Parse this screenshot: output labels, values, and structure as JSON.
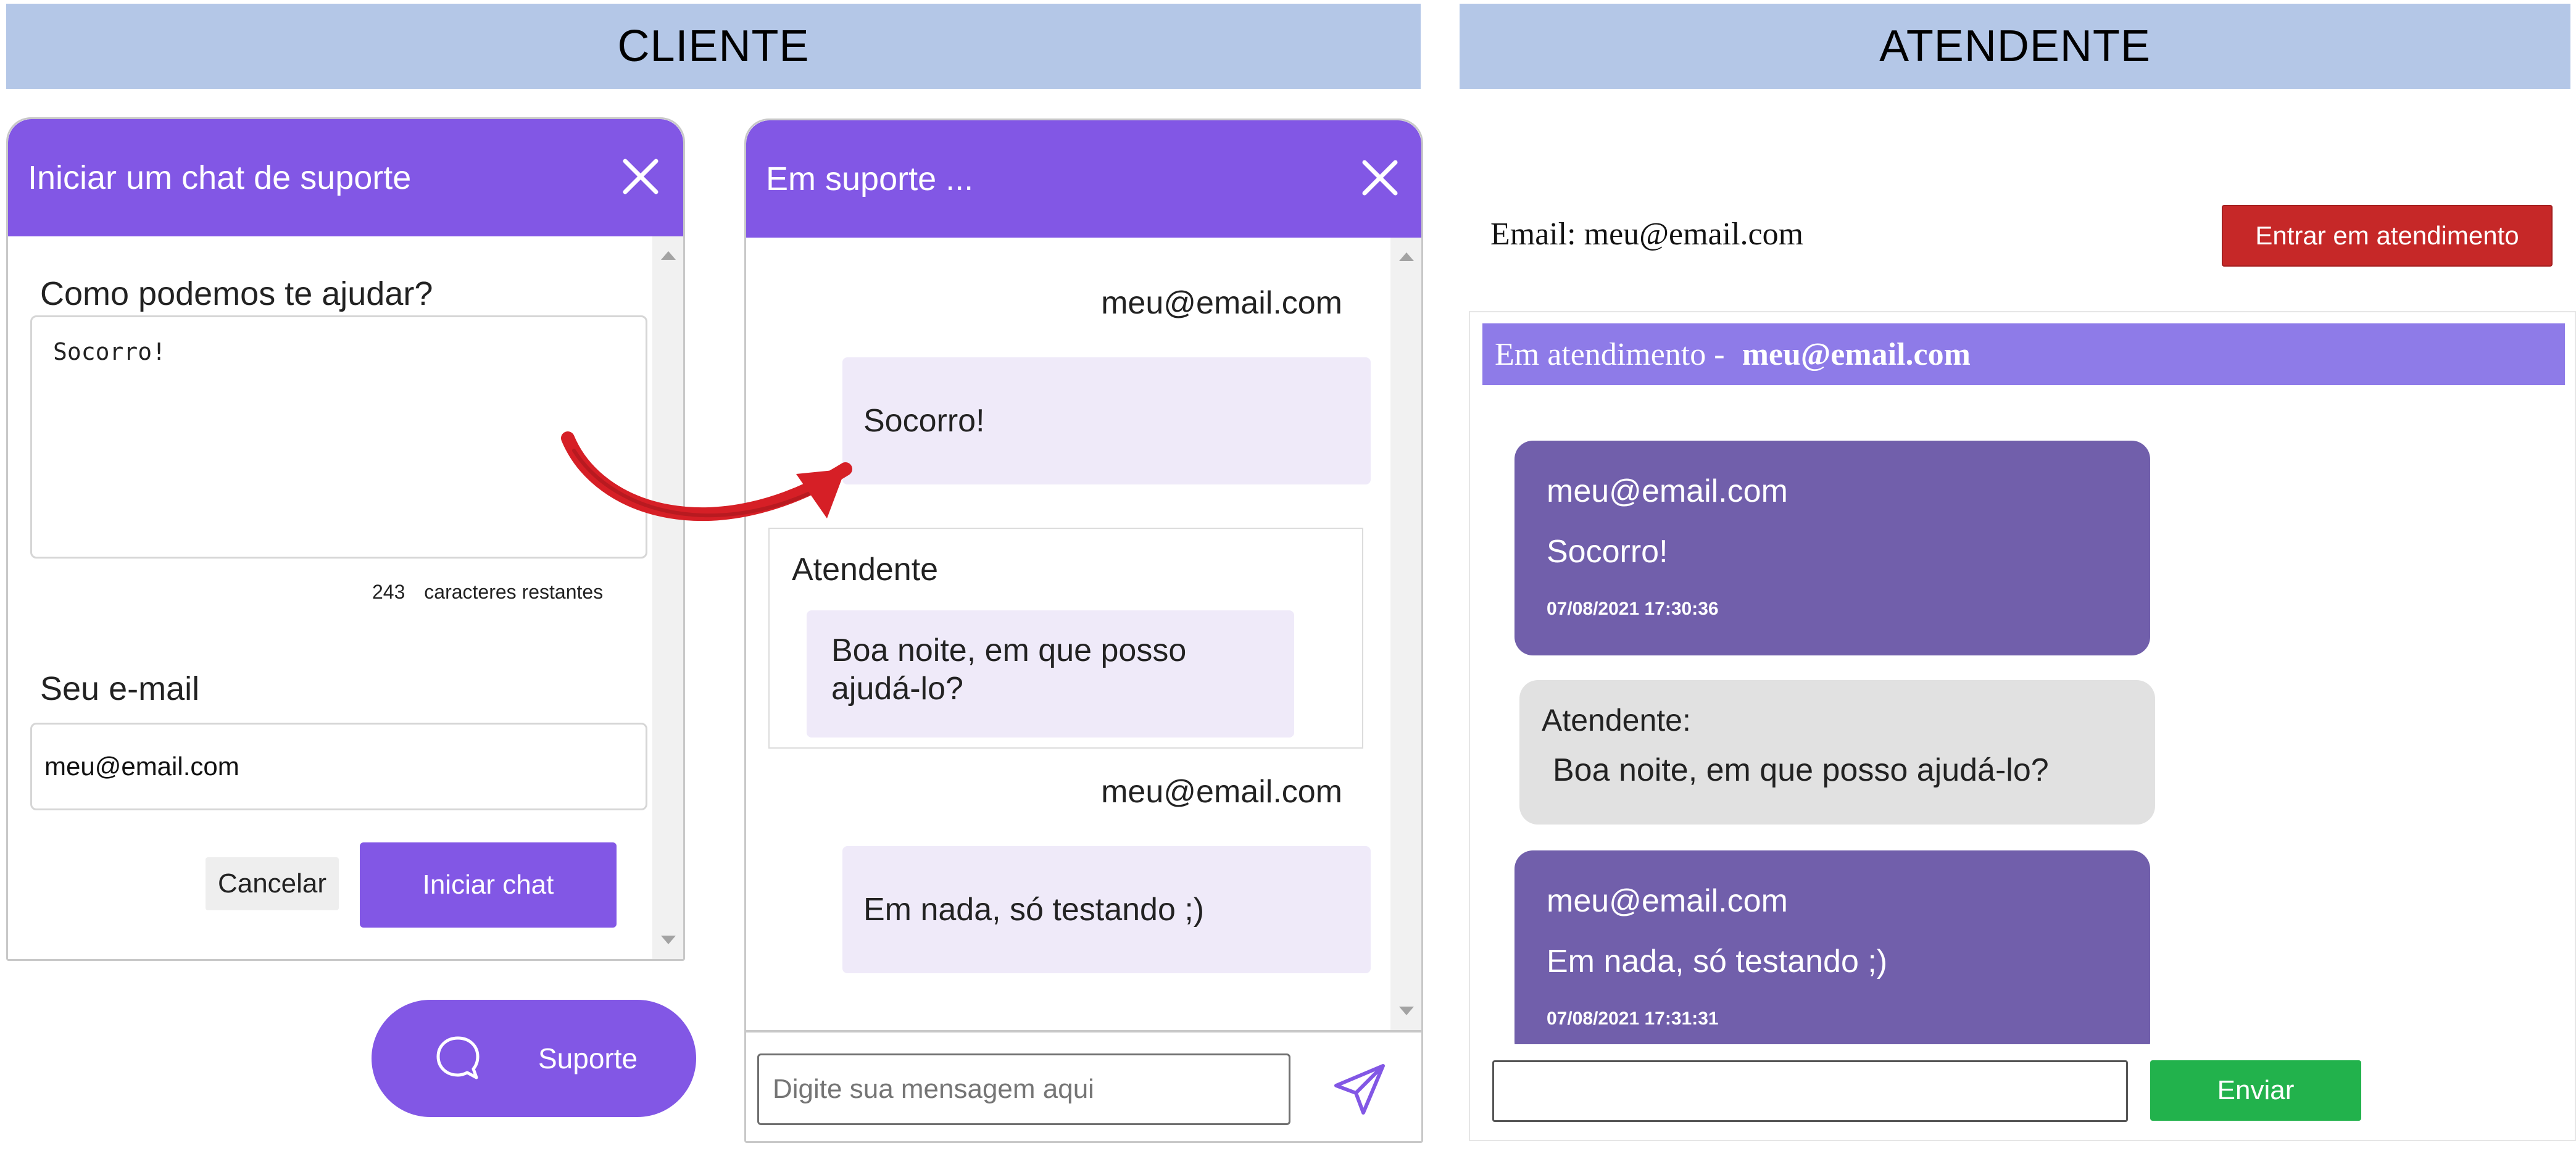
{
  "headers": {
    "client": "CLIENTE",
    "attendant": "ATENDENTE"
  },
  "start_form": {
    "title": "Iniciar um chat de suporte",
    "question_label": "Como podemos te ajudar?",
    "message_value": "Socorro!",
    "counter_value": "243",
    "counter_label": "caracteres restantes",
    "email_label": "Seu e-mail",
    "email_value": "meu@email.com",
    "cancel_label": "Cancelar",
    "start_label": "Iniciar chat"
  },
  "support_button": {
    "label": "Suporte"
  },
  "chat_window": {
    "title": "Em suporte ...",
    "messages": [
      {
        "sender": "meu@email.com",
        "text": "Socorro!"
      },
      {
        "sender": "Atendente",
        "text": "Boa noite, em que posso ajudá-lo?"
      },
      {
        "sender": "meu@email.com",
        "text": "Em nada, só testando ;)"
      }
    ],
    "input_placeholder": "Digite sua mensagem aqui"
  },
  "attendant": {
    "email_label": "Email:",
    "email_value": "meu@email.com",
    "enter_button": "Entrar em atendimento",
    "banner_prefix": "Em atendimento -",
    "banner_email": "meu@email.com",
    "messages": [
      {
        "sender": "meu@email.com",
        "text": "Socorro!",
        "time": "07/08/2021 17:30:36"
      },
      {
        "sender": "Atendente:",
        "text": "Boa noite, em que posso ajudá-lo?"
      },
      {
        "sender": "meu@email.com",
        "text": "Em nada, só testando ;)",
        "time": "07/08/2021 17:31:31"
      }
    ],
    "send_button": "Enviar"
  },
  "colors": {
    "header_band": "#b4c7e7",
    "brand_purple": "#8257e5",
    "bubble_light": "#efeaf9",
    "attendant_banner": "#8e7be8",
    "message_purple": "#715fab",
    "message_gray": "#e1e1e1",
    "enter_red": "#c62828",
    "send_green": "#22b24c",
    "arrow_red": "#d61f26"
  },
  "icons": {
    "close": "close-icon",
    "chat": "chat-bubble-icon",
    "send": "send-icon",
    "arrow": "curved-arrow-icon"
  }
}
